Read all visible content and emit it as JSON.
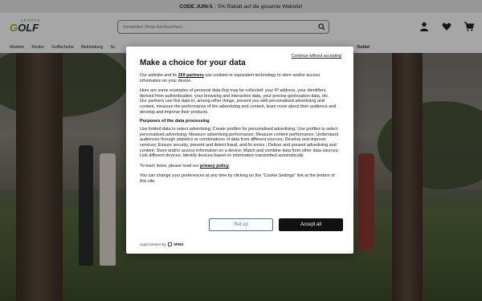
{
  "promo": {
    "code": "CODE JUIN-5",
    "text": ": 5% Rabatt auf die gesamte Website!"
  },
  "logo": {
    "sup": "SPORTS",
    "main_a": "G",
    "main_b": "OLF"
  },
  "search": {
    "placeholder": "Gesamten Shop durchsuchen..."
  },
  "header_icons": [
    "user-icon",
    "heart-icon",
    "cart-icon"
  ],
  "nav": {
    "items": [
      "Marken",
      "Kinder",
      "Golfschuhe",
      "Bekleidung",
      "Sc"
    ],
    "outlet": "Outlet"
  },
  "consent": {
    "accept_link": "Continue without accepting",
    "title": "Make a choice for your data",
    "intro_pre": "Our website and its ",
    "intro_partners": "269 partners",
    "intro_post": " use cookies or equivalent technology to store and/or access information on your device.",
    "p2": "Here are some examples of personal data that may be collected: your IP address, your identifiers derived from authentication, your browsing and interaction data, your precise geolocation data, etc.",
    "p3": "Our partners use this data to, among other things, present you with personalised advertising and content, measure the performance of the advertising and content, learn more about their audience and develop and improve their products.",
    "purposes_title": "Purposes of the data processing",
    "purposes": "Use limited data to select advertising; Create profiles for personalised advertising; Use profiles to select personalised advertising; Measure advertising performance; Measure content performance; Understand audiences through statistics or combinations of data from different sources; Develop and improve services; Ensure security, prevent and detect fraud, and fix errors ; Deliver and present advertising and content; Store and/or access information on a device; Match and combine data from other data sources; Link different devices; Identify devices based on information transmitted automatically",
    "learn_pre": "To learn more, please read our ",
    "learn_link": "privacy policy",
    "learn_post": ".",
    "change": "You can change your preferences at any time by clicking on the \"Cookie Settings\" link at the bottom of this site.",
    "setup_button": "Set up",
    "accept_button": "Accept all",
    "brand_pre": "AppConsent by",
    "brand_name": "SFBX"
  }
}
